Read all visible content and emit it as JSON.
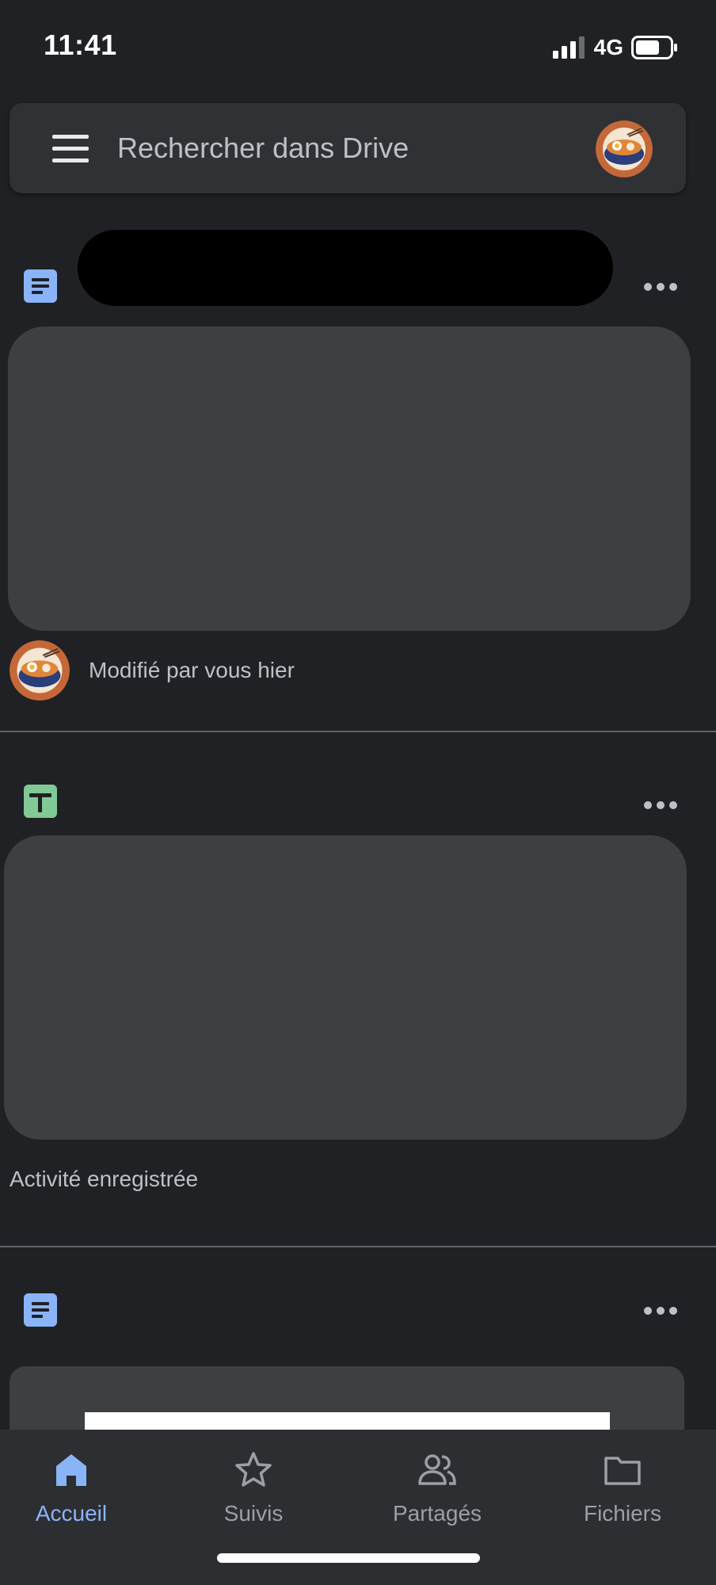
{
  "status_bar": {
    "time": "11:41",
    "network": "4G",
    "signal_bars": 3,
    "battery_level": 0.6
  },
  "search": {
    "placeholder": "Rechercher dans Drive"
  },
  "files": [
    {
      "type_icon": "docs-icon",
      "name": "",
      "activity": "Modifié par vous hier"
    },
    {
      "type_icon": "sheets-icon",
      "name": "",
      "activity": "Activité enregistrée"
    },
    {
      "type_icon": "docs-icon",
      "name": "",
      "activity": ""
    }
  ],
  "nav": {
    "items": [
      {
        "label": "Accueil",
        "icon": "home-icon",
        "active": true
      },
      {
        "label": "Suivis",
        "icon": "star-icon",
        "active": false
      },
      {
        "label": "Partagés",
        "icon": "people-icon",
        "active": false
      },
      {
        "label": "Fichiers",
        "icon": "folder-icon",
        "active": false
      }
    ]
  },
  "colors": {
    "background": "#202124",
    "surface": "#303134",
    "accent": "#8ab4f8",
    "docs": "#8ab4f8",
    "sheets": "#81c995",
    "muted_text": "#9aa0a6"
  }
}
